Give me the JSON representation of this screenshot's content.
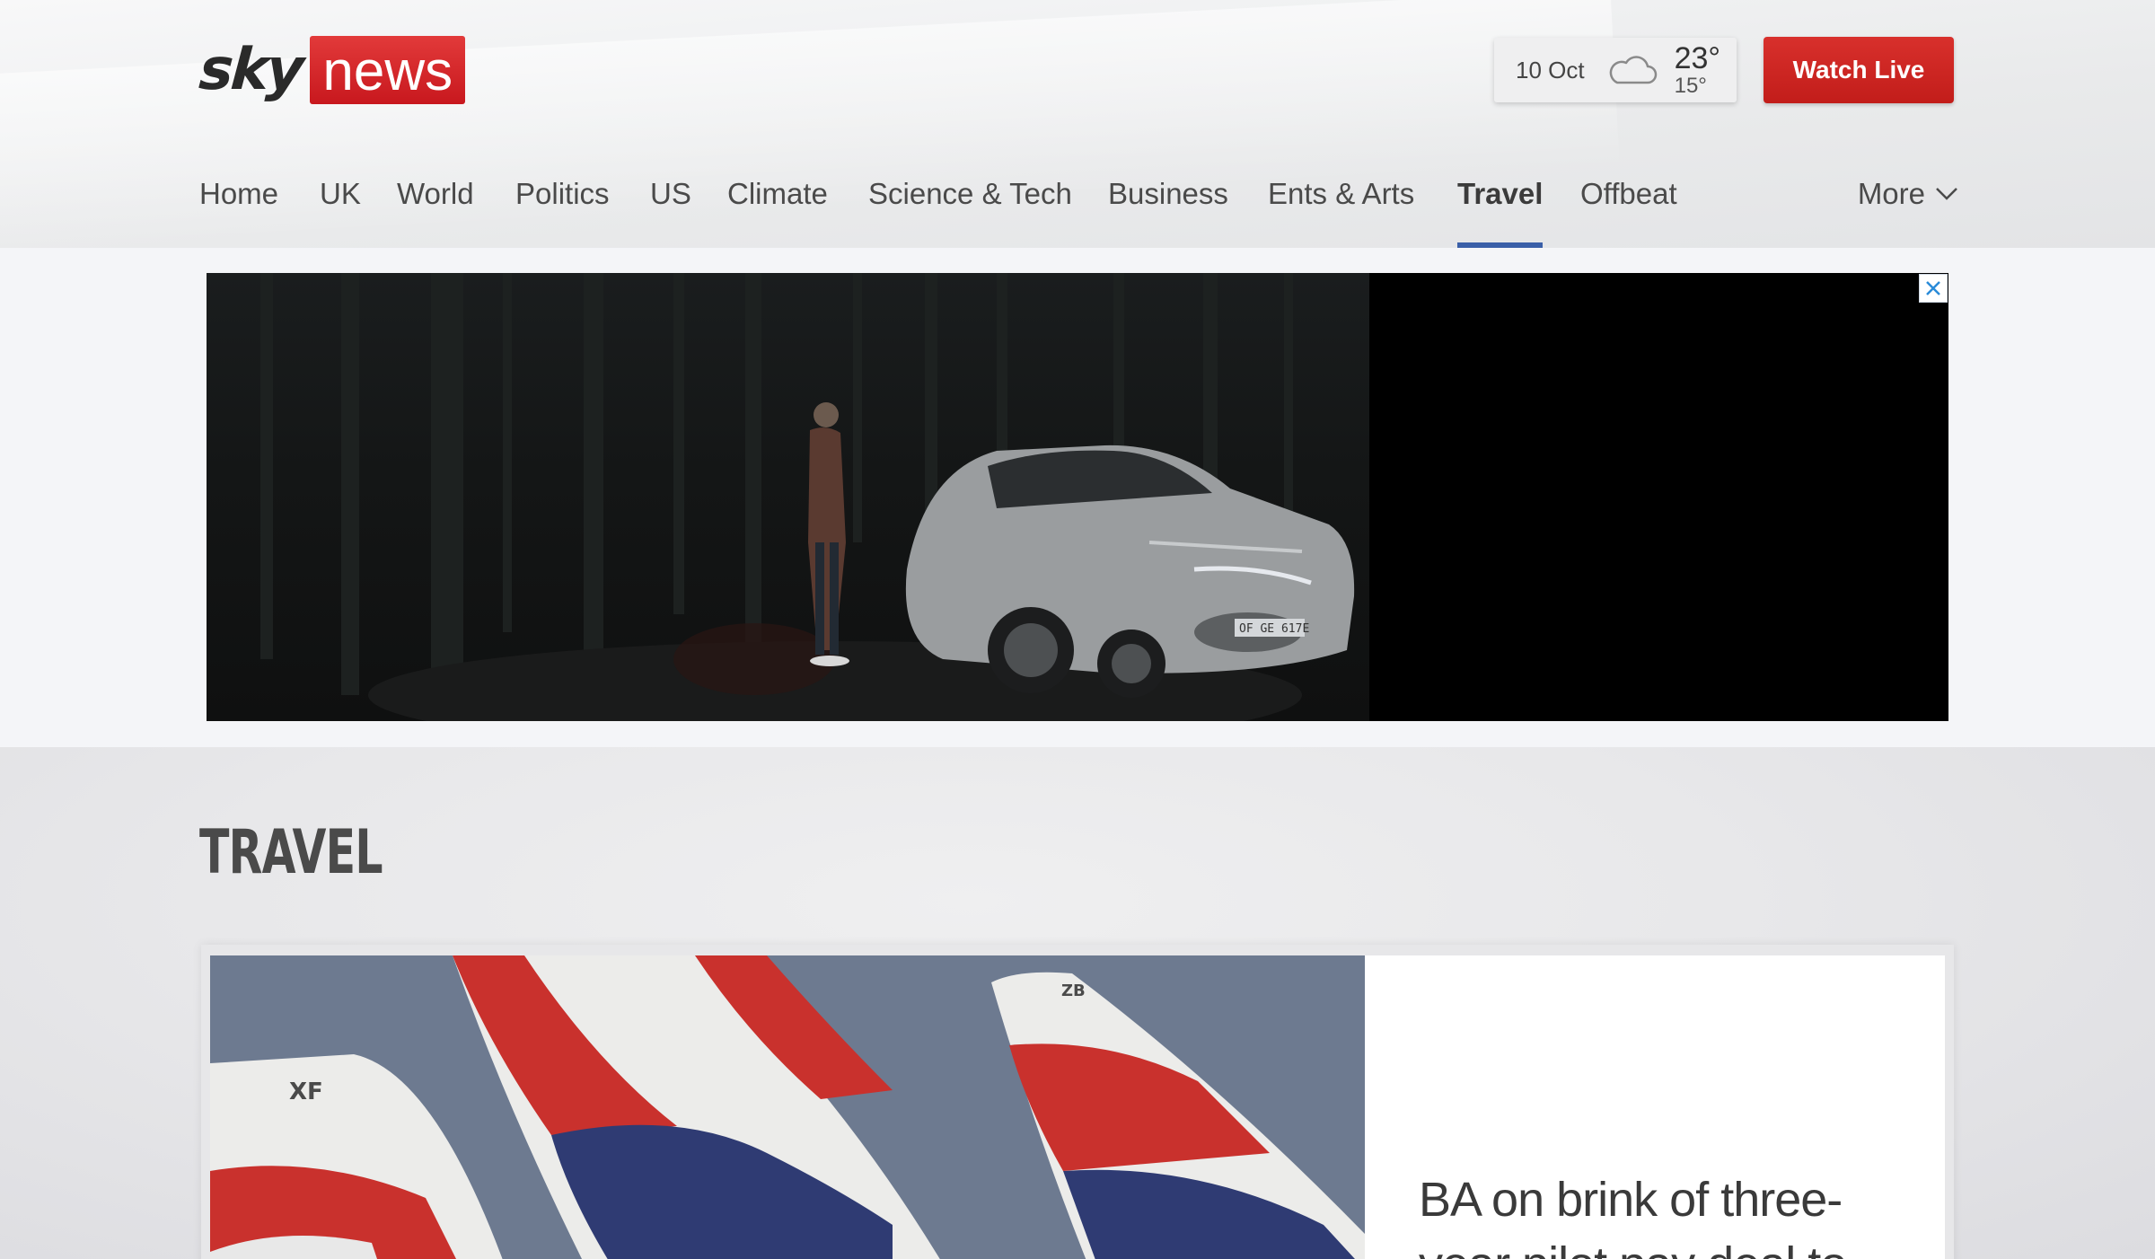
{
  "header": {
    "logo": {
      "sky": "sky",
      "news": "news"
    },
    "weather": {
      "date": "10 Oct",
      "icon": "cloud-icon",
      "high": "23°",
      "low": "15°"
    },
    "watch_live_label": "Watch Live"
  },
  "nav": {
    "items": [
      {
        "label": "Home"
      },
      {
        "label": "UK"
      },
      {
        "label": "World"
      },
      {
        "label": "Politics"
      },
      {
        "label": "US"
      },
      {
        "label": "Climate"
      },
      {
        "label": "Science & Tech"
      },
      {
        "label": "Business"
      },
      {
        "label": "Ents & Arts"
      },
      {
        "label": "Travel",
        "active": true
      },
      {
        "label": "Offbeat"
      }
    ],
    "more_label": "More",
    "active_color": "#3a5fa8"
  },
  "ad": {
    "close_icon": "close-icon",
    "plate_text": "OF GE 617E"
  },
  "section": {
    "title": "TRAVEL"
  },
  "lead_story": {
    "headline": "BA on brink of three-year pilot pay deal to",
    "image_icon": "ba-tailfins-photo",
    "tail_letters": [
      "XF",
      "ZB"
    ]
  },
  "colors": {
    "brand_red": "#c8181e",
    "accent_blue": "#3a5fa8"
  }
}
